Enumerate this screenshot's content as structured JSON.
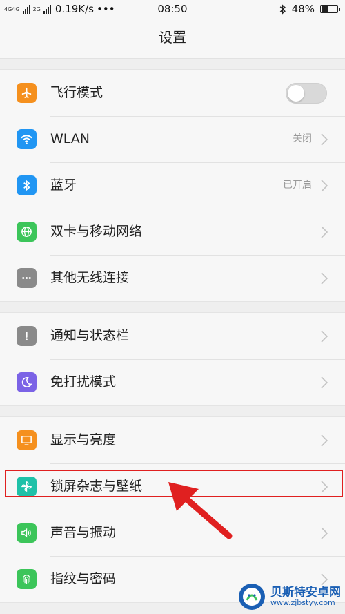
{
  "status_bar": {
    "network_types": [
      "4G",
      "4G",
      "2G"
    ],
    "speed": "0.19K/s",
    "more": "•••",
    "time": "08:50",
    "battery_text": "48%",
    "battery_level": 0.48
  },
  "header": {
    "title": "设置"
  },
  "groups": [
    {
      "items": [
        {
          "label": "飞行模式",
          "icon": "airplane-icon",
          "color": "#f5901e",
          "control": "toggle",
          "toggle_on": false
        },
        {
          "label": "WLAN",
          "icon": "wifi-icon",
          "color": "#2196f3",
          "value": "关闭",
          "control": "chevron"
        },
        {
          "label": "蓝牙",
          "icon": "bluetooth-icon",
          "color": "#2196f3",
          "value": "已开启",
          "control": "chevron"
        },
        {
          "label": "双卡与移动网络",
          "icon": "globe-icon",
          "color": "#3cc55a",
          "control": "chevron"
        },
        {
          "label": "其他无线连接",
          "icon": "dots-icon",
          "color": "#8a8a8a",
          "control": "chevron"
        }
      ]
    },
    {
      "items": [
        {
          "label": "通知与状态栏",
          "icon": "exclamation-icon",
          "color": "#8a8a8a",
          "control": "chevron"
        },
        {
          "label": "免打扰模式",
          "icon": "moon-icon",
          "color": "#7b63e6",
          "control": "chevron"
        }
      ]
    },
    {
      "items": [
        {
          "label": "显示与亮度",
          "icon": "monitor-icon",
          "color": "#f5901e",
          "control": "chevron"
        },
        {
          "label": "锁屏杂志与壁纸",
          "icon": "pinwheel-icon",
          "color": "#1fc1a8",
          "control": "chevron",
          "highlighted": true
        },
        {
          "label": "声音与振动",
          "icon": "speaker-icon",
          "color": "#3cc55a",
          "control": "chevron"
        },
        {
          "label": "指纹与密码",
          "icon": "fingerprint-icon",
          "color": "#3cc55a",
          "control": "chevron"
        }
      ]
    }
  ],
  "watermark": {
    "name": "贝斯特安卓网",
    "url": "www.zjbstyy.com",
    "icon": "watermark-logo-icon"
  },
  "colors": {
    "annotation": "#e02020"
  }
}
